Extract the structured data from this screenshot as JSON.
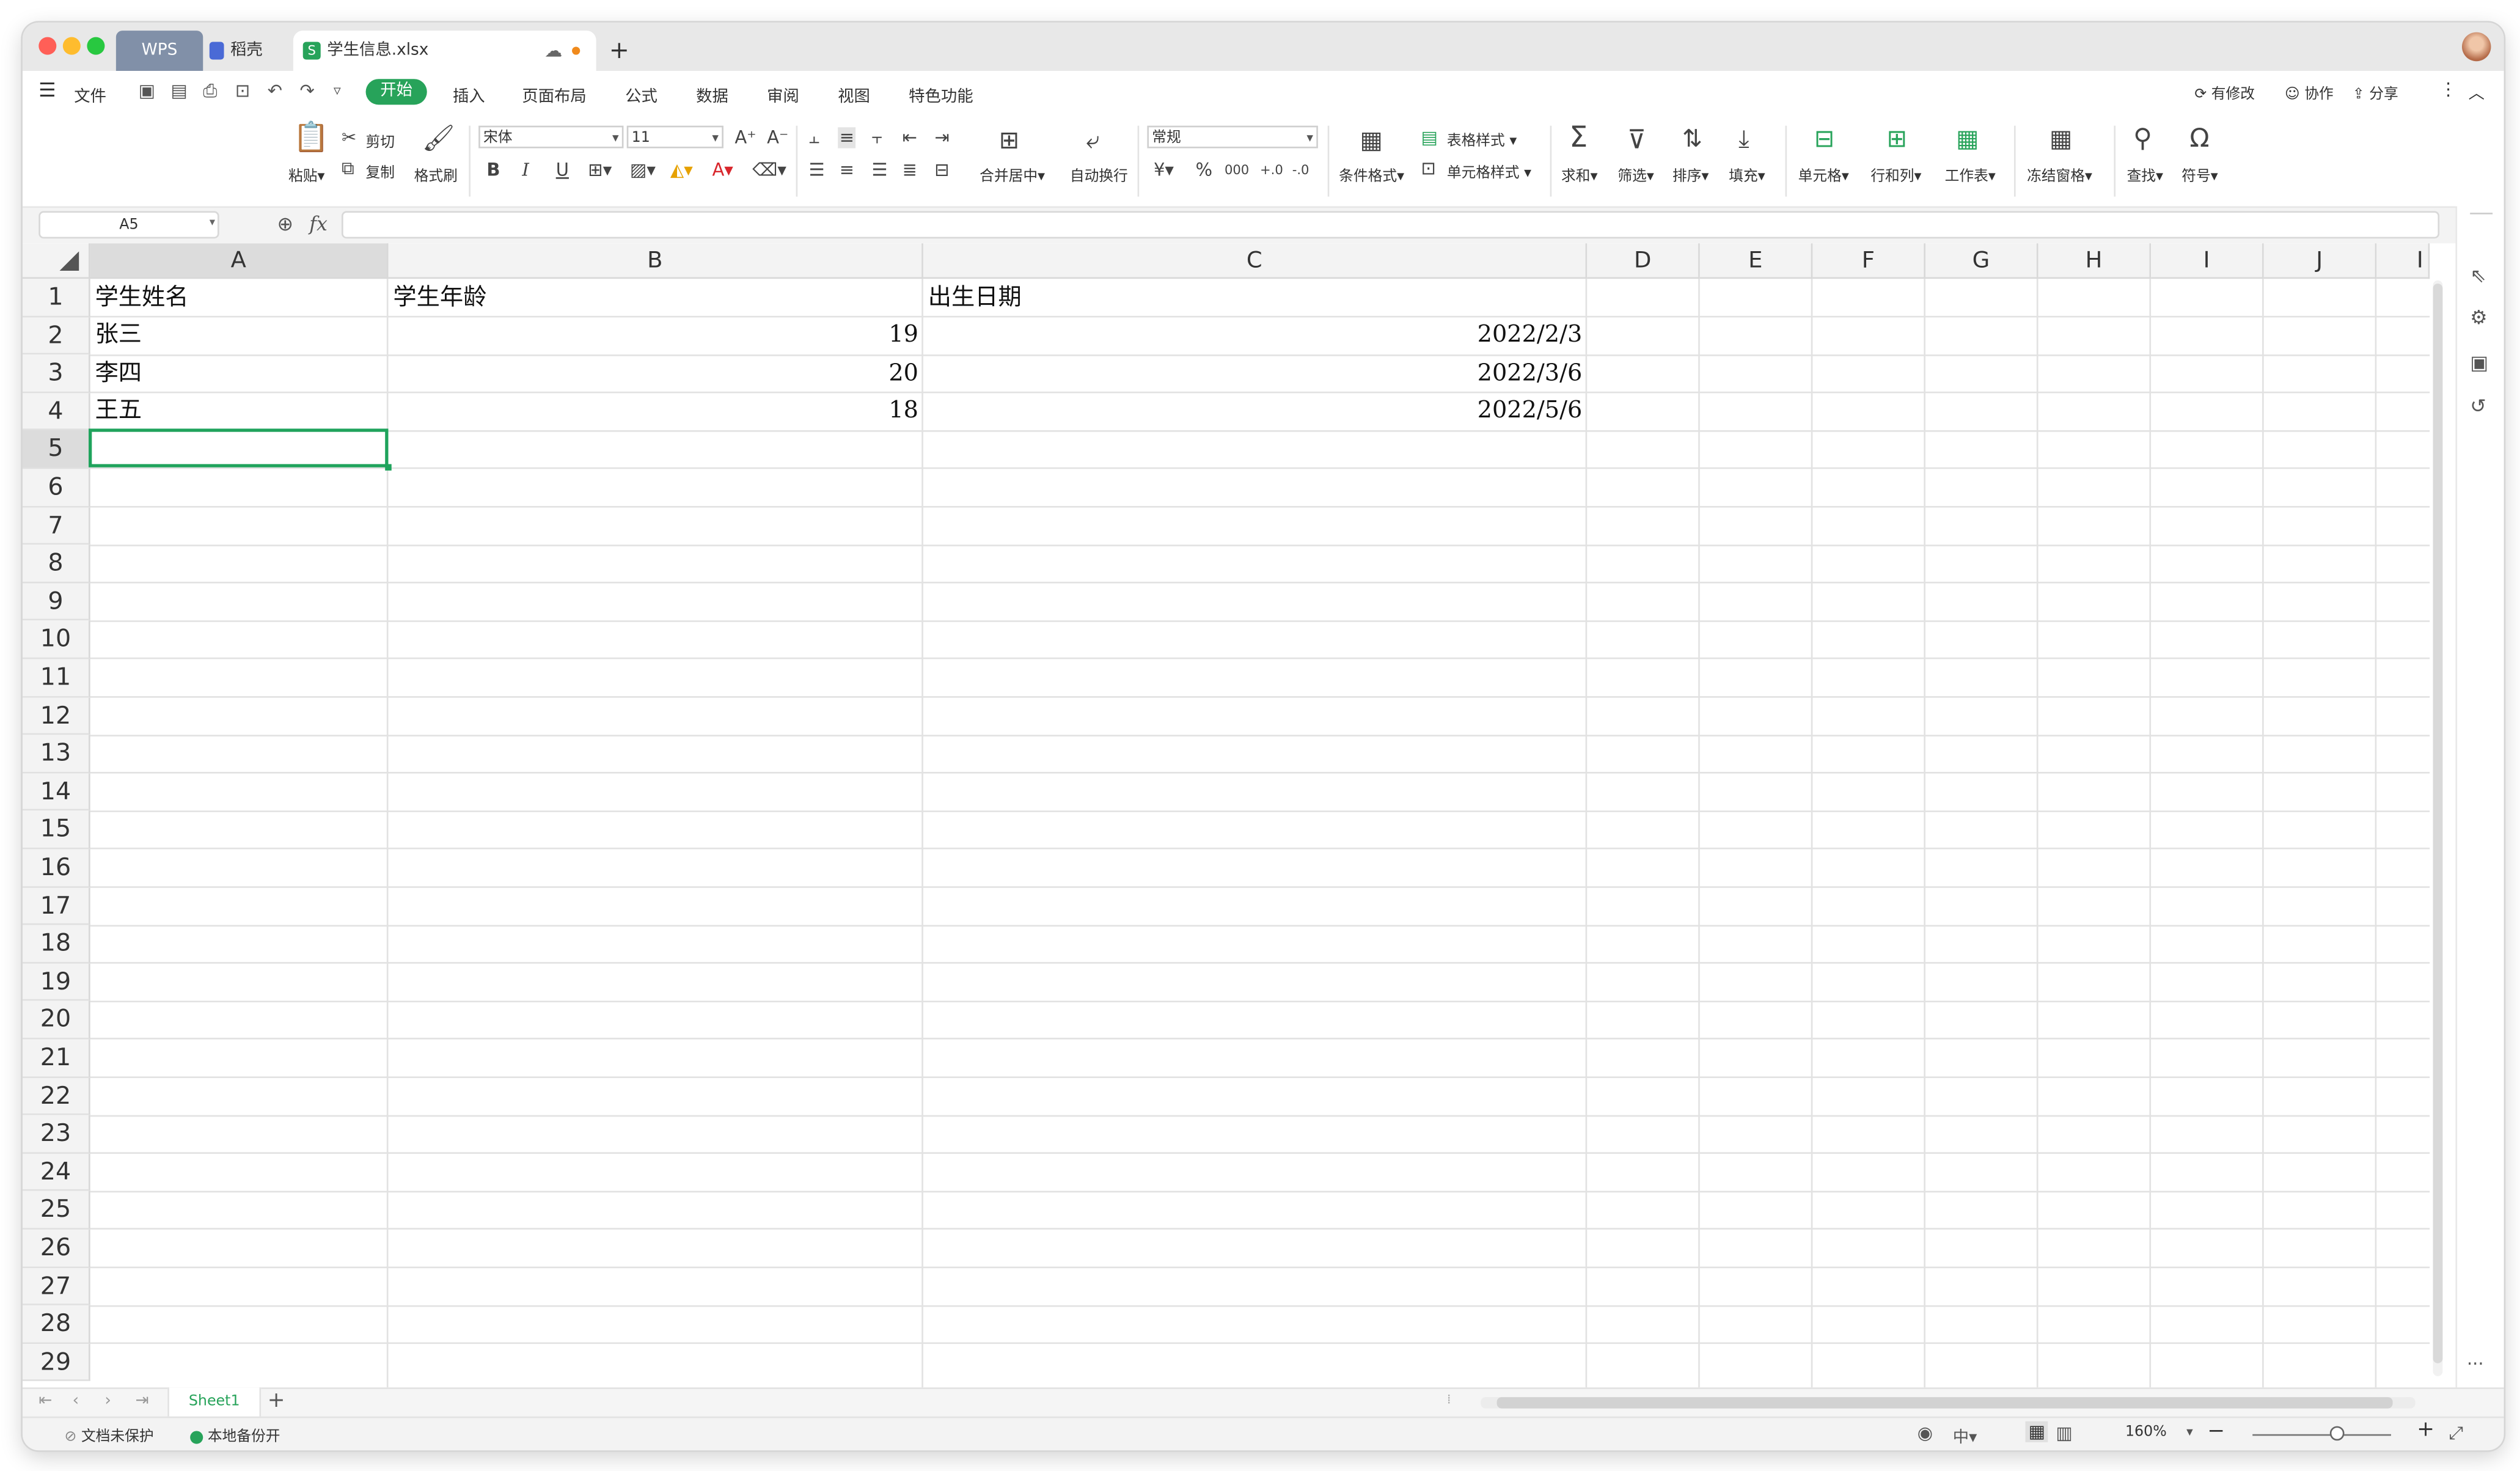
{
  "tabs": {
    "wps": "WPS",
    "daoke": "稻壳",
    "file": "学生信息.xlsx",
    "new_tab": "+"
  },
  "colors": {
    "accent": "#27a35a",
    "selection": "#1fa35c",
    "tab_wps_bg": "#8190a8"
  },
  "menu": {
    "hamburger_icon": "menu-icon",
    "file": "文件",
    "items": [
      "开始",
      "插入",
      "页面布局",
      "公式",
      "数据",
      "审阅",
      "视图",
      "特色功能"
    ],
    "right": [
      "有修改",
      "协作",
      "分享"
    ]
  },
  "ribbon": {
    "paste": "粘贴",
    "cut": "剪切",
    "copy": "复制",
    "format_painter": "格式刷",
    "font_name": "宋体",
    "font_size": "11",
    "merge_center": "合并居中",
    "wrap_text": "自动换行",
    "number_format": "常规",
    "currency": "¥",
    "percent": "%",
    "thousands": "000",
    "inc_decimal": "+.0",
    "dec_decimal": "-.0",
    "cond_format": "条件格式",
    "table_style": "表格样式",
    "cell_style": "单元格样式",
    "sum": "求和",
    "filter": "筛选",
    "sort": "排序",
    "fill": "填充",
    "cells": "单元格",
    "rows_cols": "行和列",
    "worksheet": "工作表",
    "freeze": "冻结窗格",
    "find": "查找",
    "symbol": "符号"
  },
  "formula_bar": {
    "name_box": "A5",
    "fx": "fx",
    "content": ""
  },
  "grid": {
    "columns": [
      "A",
      "B",
      "C",
      "D",
      "E",
      "F",
      "G",
      "H",
      "I",
      "J",
      "I"
    ],
    "rows": [
      "1",
      "2",
      "3",
      "4",
      "5",
      "6",
      "7",
      "8",
      "9",
      "10",
      "11",
      "12",
      "13",
      "14",
      "15",
      "16",
      "17",
      "18",
      "19",
      "20",
      "21",
      "22",
      "23",
      "24",
      "25",
      "26",
      "27",
      "28",
      "29"
    ],
    "cells": {
      "A1": "学生姓名",
      "B1": "学生年龄",
      "C1": "出生日期",
      "A2": "张三",
      "B2": "19",
      "C2": "2022/2/3",
      "A3": "李四",
      "B3": "20",
      "C3": "2022/3/6",
      "A4": "王五",
      "B4": "18",
      "C4": "2022/5/6"
    },
    "selected_cell": "A5"
  },
  "sheets": {
    "active": "Sheet1",
    "add": "+"
  },
  "status": {
    "protect": "文档未保护",
    "backup": "本地备份开",
    "zoom": "160%",
    "zoom_out": "−",
    "zoom_in": "+"
  }
}
